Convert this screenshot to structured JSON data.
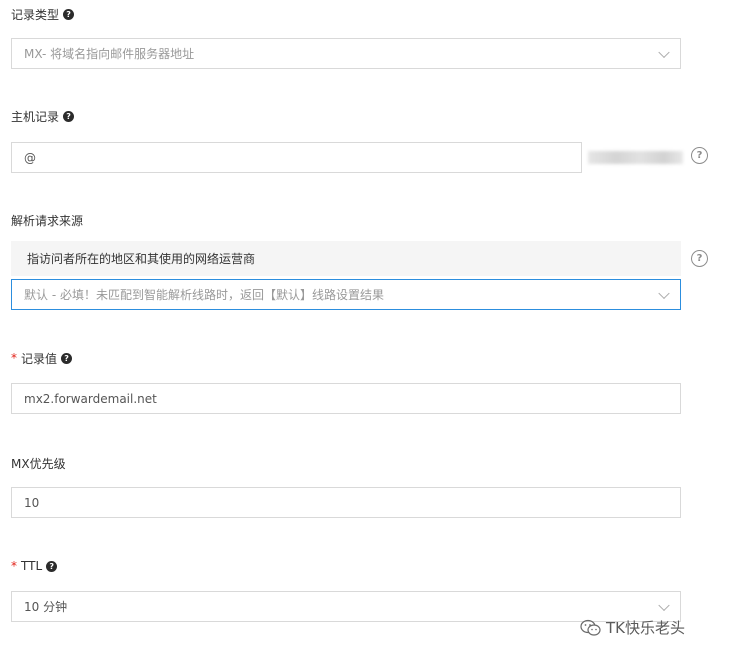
{
  "record_type": {
    "label": "记录类型",
    "help_glyph": "?",
    "value": "MX- 将域名指向邮件服务器地址"
  },
  "host_record": {
    "label": "主机记录",
    "help_glyph": "?",
    "value": "@"
  },
  "resolution_source": {
    "label": "解析请求来源",
    "description": "指访问者所在的地区和其使用的网络运营商",
    "value": "默认 - 必填！未匹配到智能解析线路时，返回【默认】线路设置结果"
  },
  "record_value": {
    "required_mark": "*",
    "label": "记录值",
    "help_glyph": "?",
    "value": "mx2.forwardemail.net"
  },
  "mx_priority": {
    "label": "MX优先级",
    "value": "10"
  },
  "ttl": {
    "required_mark": "*",
    "label": "TTL",
    "help_glyph": "?",
    "value": "10 分钟"
  },
  "watermark": {
    "text": "TK快乐老头"
  },
  "icons": {
    "help_filled": "help-circle-filled-icon",
    "help_outline": "help-circle-outline-icon",
    "dropdown": "chevron-down-icon",
    "watermark_logo": "wechat-icon"
  },
  "colors": {
    "focus_border": "#2c8ede",
    "required": "#e2231a",
    "input_border": "#d9d9d9",
    "info_bar_bg": "#f5f5f5"
  }
}
